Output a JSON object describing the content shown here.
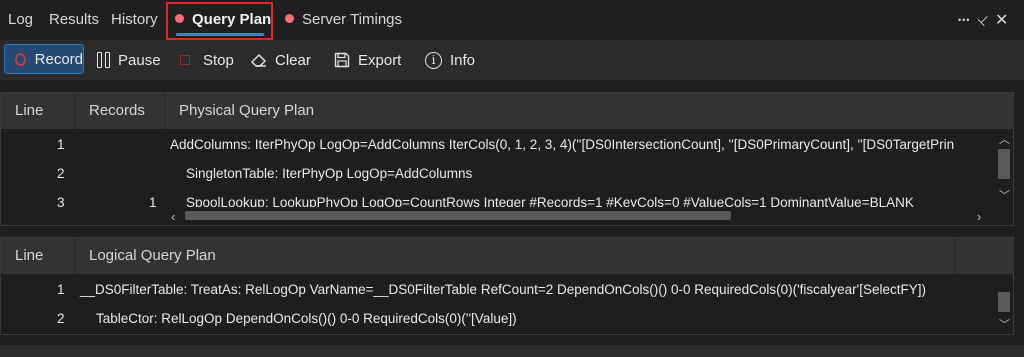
{
  "tabs": {
    "log": "Log",
    "results": "Results",
    "history": "History",
    "query_plan": "Query Plan",
    "server_timings": "Server Timings"
  },
  "window_controls": {
    "more": "•••",
    "pin": "⊥",
    "close": "✕"
  },
  "toolbar": {
    "record": "Record",
    "pause": "Pause",
    "stop": "Stop",
    "clear": "Clear",
    "export": "Export",
    "info": "Info"
  },
  "physical_plan": {
    "columns": [
      "Line",
      "Records",
      "Physical Query Plan"
    ],
    "rows": [
      {
        "line": "1",
        "records": "",
        "plan": "AddColumns: IterPhyOp LogOp=AddColumns IterCols(0, 1, 2, 3, 4)(''[DS0IntersectionCount], ''[DS0PrimaryCount], ''[DS0TargetPrin"
      },
      {
        "line": "2",
        "records": "",
        "plan": "SingletonTable: IterPhyOp LogOp=AddColumns"
      },
      {
        "line": "3",
        "records": "1",
        "plan": "SpoolLookup: LookupPhyOp LogOp=CountRows Integer #Records=1 #KeyCols=0 #ValueCols=1 DominantValue=BLANK"
      }
    ]
  },
  "logical_plan": {
    "columns": [
      "Line",
      "Logical Query Plan"
    ],
    "rows": [
      {
        "line": "1",
        "plan": "__DS0FilterTable: TreatAs: RelLogOp VarName=__DS0FilterTable RefCount=2 DependOnCols()() 0-0 RequiredCols(0)('fiscalyear'[SelectFY])"
      },
      {
        "line": "2",
        "plan": "TableCtor: RelLogOp DependOnCols()() 0-0 RequiredCols(0)(''[Value])"
      }
    ]
  }
}
